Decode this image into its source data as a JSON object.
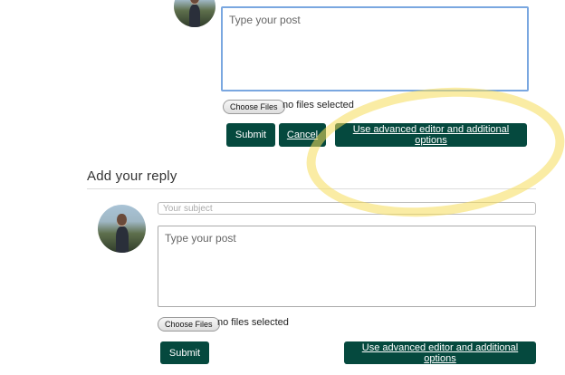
{
  "top_editor": {
    "placeholder": "Type your post",
    "choose_files_label": "Choose Files",
    "file_status": "no files selected",
    "submit_label": "Submit",
    "cancel_label": "Cancel",
    "advanced_label": "Use advanced editor and additional options"
  },
  "reply": {
    "heading": "Add your reply",
    "subject_placeholder": "Your subject",
    "placeholder": "Type your post",
    "choose_files_label": "Choose Files",
    "file_status": "no files selected",
    "submit_label": "Submit",
    "advanced_label": "Use advanced editor and additional options"
  },
  "colors": {
    "button_bg": "#05493e",
    "highlight": "#f5dc5a",
    "focus_border": "#7aa7e0"
  }
}
